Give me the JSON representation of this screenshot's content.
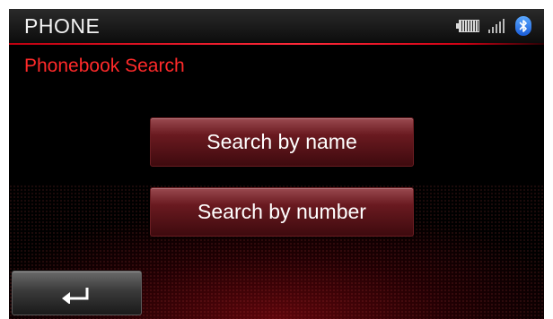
{
  "header": {
    "title": "PHONE",
    "status_icons": [
      "battery-icon",
      "signal-strength-icon",
      "bluetooth-icon"
    ]
  },
  "screen": {
    "subtitle": "Phonebook Search"
  },
  "menu": {
    "items": [
      {
        "label": "Search by name"
      },
      {
        "label": "Search by number"
      }
    ]
  },
  "footer": {
    "back_icon": "back-arrow-icon"
  },
  "colors": {
    "accent_red": "#ff2a2a",
    "background": "#000000",
    "bluetooth_blue": "#2a6ae0"
  }
}
